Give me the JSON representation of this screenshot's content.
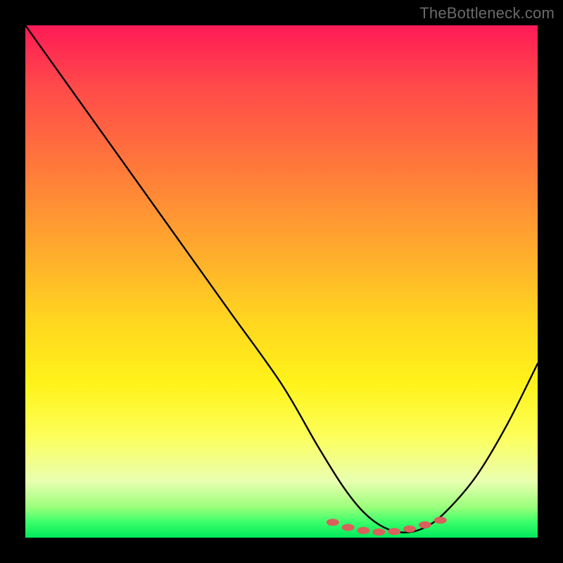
{
  "attribution": "TheBottleneck.com",
  "chart_data": {
    "type": "line",
    "title": "",
    "xlabel": "",
    "ylabel": "",
    "xlim": [
      0,
      100
    ],
    "ylim": [
      0,
      100
    ],
    "series": [
      {
        "name": "bottleneck-curve",
        "x": [
          0,
          10,
          20,
          30,
          40,
          50,
          57,
          62,
          66,
          70,
          74,
          78,
          82,
          88,
          94,
          100
        ],
        "values": [
          100,
          86,
          72,
          58,
          44,
          30,
          18,
          10,
          5,
          2,
          1,
          2,
          5,
          12,
          22,
          34
        ]
      }
    ],
    "markers": {
      "name": "highlight-dots",
      "x": [
        60,
        63,
        66,
        69,
        72,
        75,
        78,
        81
      ],
      "values": [
        3.0,
        2.0,
        1.4,
        1.1,
        1.2,
        1.7,
        2.5,
        3.4
      ],
      "color": "#d9605b"
    },
    "gradient_stops": [
      {
        "pos": 0,
        "color": "#ff1a56"
      },
      {
        "pos": 12,
        "color": "#ff4a4a"
      },
      {
        "pos": 28,
        "color": "#ff7a3a"
      },
      {
        "pos": 44,
        "color": "#ffab2d"
      },
      {
        "pos": 58,
        "color": "#ffd71f"
      },
      {
        "pos": 70,
        "color": "#fff31a"
      },
      {
        "pos": 80,
        "color": "#fdff59"
      },
      {
        "pos": 89,
        "color": "#e9ffb1"
      },
      {
        "pos": 94,
        "color": "#9cff7c"
      },
      {
        "pos": 97,
        "color": "#3aff6a"
      },
      {
        "pos": 100,
        "color": "#00e85c"
      }
    ]
  }
}
